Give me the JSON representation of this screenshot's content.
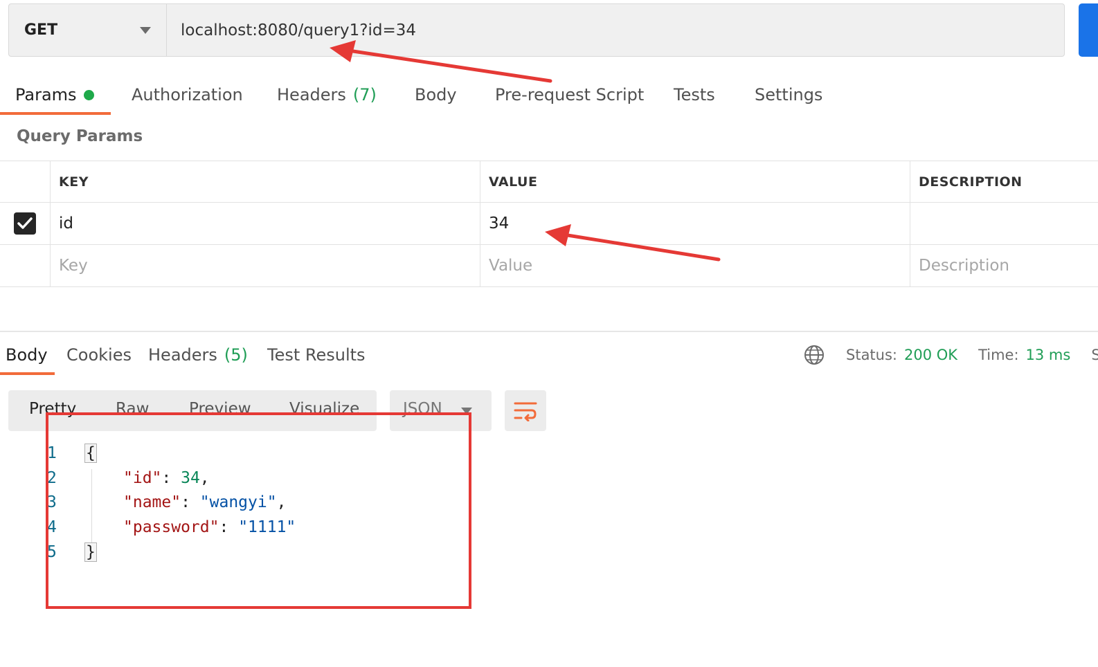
{
  "request": {
    "method": "GET",
    "url": "localhost:8080/query1?id=34"
  },
  "request_tabs": [
    {
      "label": "Params",
      "count": "",
      "active": true
    },
    {
      "label": "Authorization",
      "count": ""
    },
    {
      "label": "Headers",
      "count": "(7)"
    },
    {
      "label": "Body",
      "count": ""
    },
    {
      "label": "Pre-request Script",
      "count": ""
    },
    {
      "label": "Tests",
      "count": ""
    },
    {
      "label": "Settings",
      "count": ""
    }
  ],
  "query_params": {
    "title": "Query Params",
    "headers": {
      "key": "KEY",
      "value": "VALUE",
      "description": "DESCRIPTION"
    },
    "rows": [
      {
        "checked": true,
        "key": "id",
        "value": "34",
        "description": ""
      }
    ],
    "placeholders": {
      "key": "Key",
      "value": "Value",
      "description": "Description"
    }
  },
  "response_tabs": [
    {
      "label": "Body",
      "count": "",
      "active": true
    },
    {
      "label": "Cookies",
      "count": ""
    },
    {
      "label": "Headers",
      "count": "(5)"
    },
    {
      "label": "Test Results",
      "count": ""
    }
  ],
  "status": {
    "status_label": "Status:",
    "status_value": "200 OK",
    "time_label": "Time:",
    "time_value": "13 ms",
    "size_label": "S"
  },
  "format_bar": {
    "modes": [
      "Pretty",
      "Raw",
      "Preview",
      "Visualize"
    ],
    "active": "Pretty",
    "language": "JSON"
  },
  "response_body": {
    "line_numbers": [
      "1",
      "2",
      "3",
      "4",
      "5"
    ],
    "open_brace": "{",
    "close_brace": "}",
    "fields": [
      {
        "key": "\"id\"",
        "value": "34",
        "type": "number",
        "comma": ","
      },
      {
        "key": "\"name\"",
        "value": "\"wangyi\"",
        "type": "string",
        "comma": ","
      },
      {
        "key": "\"password\"",
        "value": "\"1111\"",
        "type": "string",
        "comma": ""
      }
    ]
  },
  "colors": {
    "accent": "#f26b3a",
    "success": "#1f9d55",
    "annotation": "#e53935",
    "send": "#1a73e8"
  }
}
